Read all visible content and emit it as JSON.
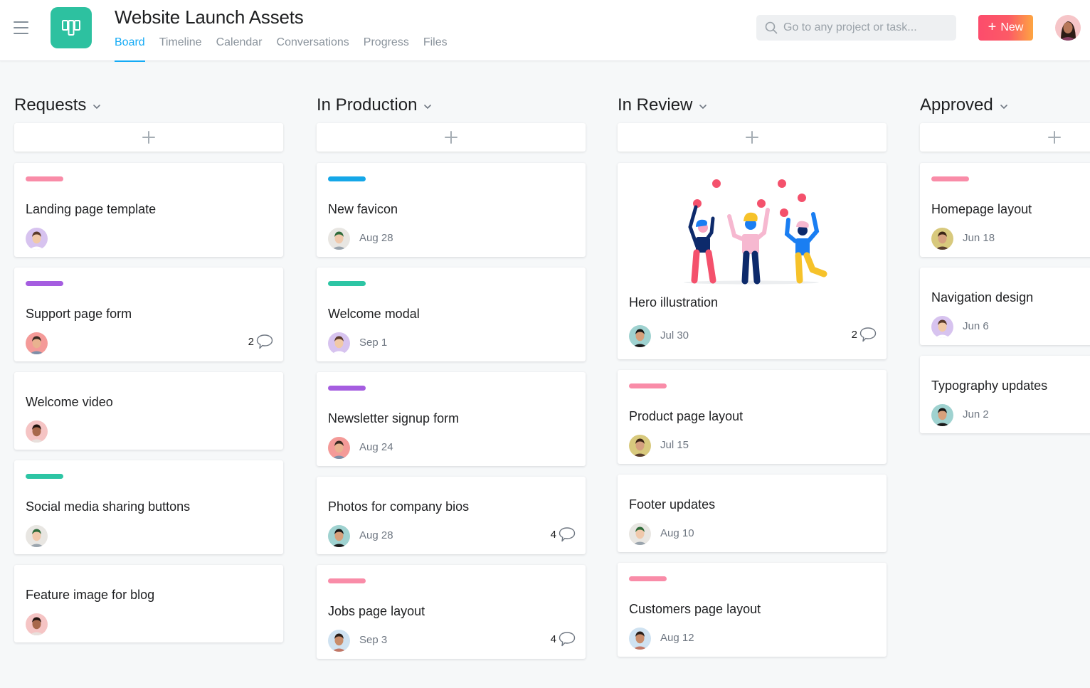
{
  "header": {
    "menu_icon": "hamburger-icon",
    "project_icon": "board-icon",
    "project_title": "Website Launch Assets",
    "tabs": [
      {
        "label": "Board",
        "active": true
      },
      {
        "label": "Timeline",
        "active": false
      },
      {
        "label": "Calendar",
        "active": false
      },
      {
        "label": "Conversations",
        "active": false
      },
      {
        "label": "Progress",
        "active": false
      },
      {
        "label": "Files",
        "active": false
      }
    ],
    "search": {
      "placeholder": "Go to any project or task...",
      "value": ""
    },
    "new_button": {
      "icon": "plus-icon",
      "label": "New"
    },
    "user_avatar": "user-avatar"
  },
  "colors": {
    "accent": "#14aaf5",
    "project_logo": "#2dc1a0",
    "tag_pink": "#f98ca8",
    "tag_purple": "#a55de0",
    "tag_teal": "#2dc5a4",
    "tag_blue": "#15a7e8",
    "new_button_start": "#fc4c6c",
    "new_button_end": "#fda541"
  },
  "columns": [
    {
      "title": "Requests",
      "cards": [
        {
          "tag": "pink",
          "title": "Landing page template",
          "avatar": "woman-bangs",
          "due": "",
          "comments": ""
        },
        {
          "tag": "purple",
          "title": "Support page form",
          "avatar": "man-smiling",
          "due": "",
          "comments": "2"
        },
        {
          "tag": "",
          "title": "Welcome video",
          "avatar": "woman-longhair",
          "due": "",
          "comments": ""
        },
        {
          "tag": "teal",
          "title": "Social media sharing buttons",
          "avatar": "person-greenhat",
          "due": "",
          "comments": ""
        },
        {
          "tag": "",
          "title": "Feature image for blog",
          "avatar": "woman-longhair",
          "due": "",
          "comments": ""
        }
      ]
    },
    {
      "title": "In Production",
      "cards": [
        {
          "tag": "blue",
          "title": "New favicon",
          "avatar": "person-greenhat",
          "due": "Aug 28",
          "comments": ""
        },
        {
          "tag": "teal",
          "title": "Welcome modal",
          "avatar": "woman-bangs",
          "due": "Sep 1",
          "comments": ""
        },
        {
          "tag": "purple",
          "title": "Newsletter signup form",
          "avatar": "man-smiling",
          "due": "Aug 24",
          "comments": ""
        },
        {
          "tag": "",
          "title": "Photos for company bios",
          "avatar": "person-shorthair",
          "due": "Aug 28",
          "comments": "4"
        },
        {
          "tag": "pink",
          "title": "Jobs page layout",
          "avatar": "man-glasses",
          "due": "Sep 3",
          "comments": "4"
        }
      ]
    },
    {
      "title": "In Review",
      "cards": [
        {
          "tag": "",
          "image": "juggling-people-illustration",
          "title": "Hero illustration",
          "avatar": "person-shorthair",
          "due": "Jul 30",
          "comments": "2"
        },
        {
          "tag": "pink",
          "title": "Product page layout",
          "avatar": "woman-curly",
          "due": "Jul 15",
          "comments": ""
        },
        {
          "tag": "",
          "title": "Footer updates",
          "avatar": "person-greenhat",
          "due": "Aug 10",
          "comments": ""
        },
        {
          "tag": "pink",
          "title": "Customers page layout",
          "avatar": "man-glasses",
          "due": "Aug 12",
          "comments": ""
        }
      ]
    },
    {
      "title": "Approved",
      "cards": [
        {
          "tag": "pink",
          "title": "Homepage layout",
          "avatar": "woman-curly",
          "due": "Jun 18",
          "comments": ""
        },
        {
          "tag": "",
          "title": "Navigation design",
          "avatar": "woman-bangs",
          "due": "Jun 6",
          "comments": ""
        },
        {
          "tag": "",
          "title": "Typography updates",
          "avatar": "person-shorthair",
          "due": "Jun 2",
          "comments": ""
        }
      ]
    }
  ]
}
